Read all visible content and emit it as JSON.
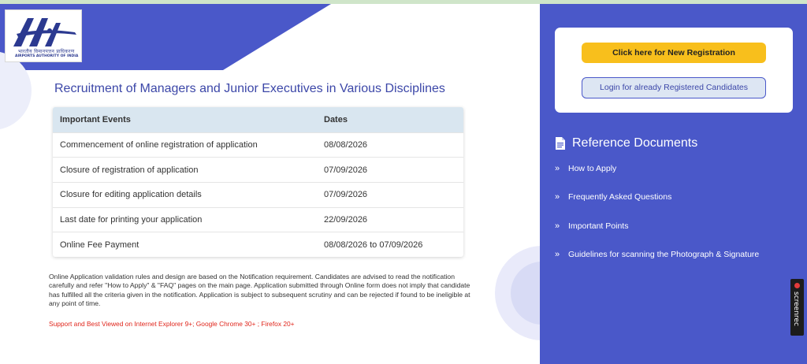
{
  "logo": {
    "hindi_text": "भारतीय विमानपत्तन प्राधिकरण",
    "english_text": "AIRPORTS AUTHORITY OF INDIA"
  },
  "page_title": "Recruitment of Managers and Junior Executives in Various Disciplines",
  "events_table": {
    "headers": [
      "Important Events",
      "Dates"
    ],
    "rows": [
      {
        "event": "Commencement of online registration of application",
        "date": "08/08/2026"
      },
      {
        "event": "Closure of registration of application",
        "date": "07/09/2026"
      },
      {
        "event": "Closure for editing application details",
        "date": "07/09/2026"
      },
      {
        "event": "Last date for printing your application",
        "date": "22/09/2026"
      },
      {
        "event": "Online Fee Payment",
        "date": "08/08/2026 to 07/09/2026"
      }
    ]
  },
  "notice": "Online Application validation rules and design are based on the Notification requirement. Candidates are advised to read the notification carefully and refer \"How to Apply\" & \"FAQ\" pages on the main page. Application submitted through Online form does not imply that candidate has fulfilled all the criteria given in the notification. Application is subject to subsequent scrutiny and can be rejected if found to be ineligible at any point of time.",
  "support_text": "Support and Best Viewed on Internet Explorer 9+; Google Chrome 30+ ; Firefox 20+",
  "registration": {
    "new_label": "Click here for New Registration",
    "login_label": "Login for already Registered Candidates"
  },
  "reference": {
    "title": "Reference Documents",
    "icon": "document-icon",
    "items": [
      {
        "label": "How to Apply"
      },
      {
        "label": "Frequently Asked Questions"
      },
      {
        "label": "Important Points"
      },
      {
        "label": "Guidelines for scanning the Photograph & Signature"
      }
    ]
  },
  "screenrec": {
    "label": "screenrec"
  },
  "colors": {
    "primary": "#4a58c9",
    "accent": "#f8bf1c",
    "title_text": "#3c47a8",
    "warning": "#e0261c"
  }
}
